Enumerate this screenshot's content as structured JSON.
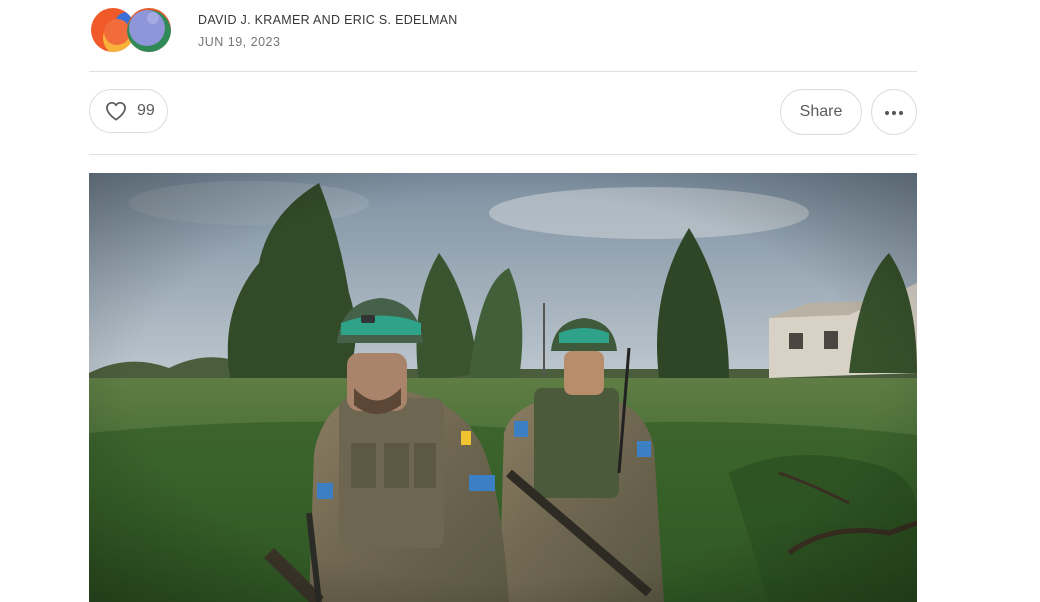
{
  "post": {
    "authors": "DAVID J. KRAMER AND ERIC S. EDELMAN",
    "date": "JUN 19, 2023"
  },
  "actions": {
    "like_count": "99",
    "share_label": "Share",
    "like_icon": "heart-icon",
    "more_icon": "ellipsis-icon"
  },
  "avatars": [
    {
      "name": "author-avatar-1",
      "colors": [
        "#f05a28",
        "#f8b23a",
        "#3a6fd8"
      ]
    },
    {
      "name": "author-avatar-2",
      "colors": [
        "#8e95d8",
        "#2f8a57",
        "#e25a2a"
      ]
    }
  ],
  "hero_image": {
    "icon": "photo"
  },
  "colors": {
    "text_primary": "#363737",
    "text_secondary": "#757575",
    "border": "#dcdcdc"
  }
}
